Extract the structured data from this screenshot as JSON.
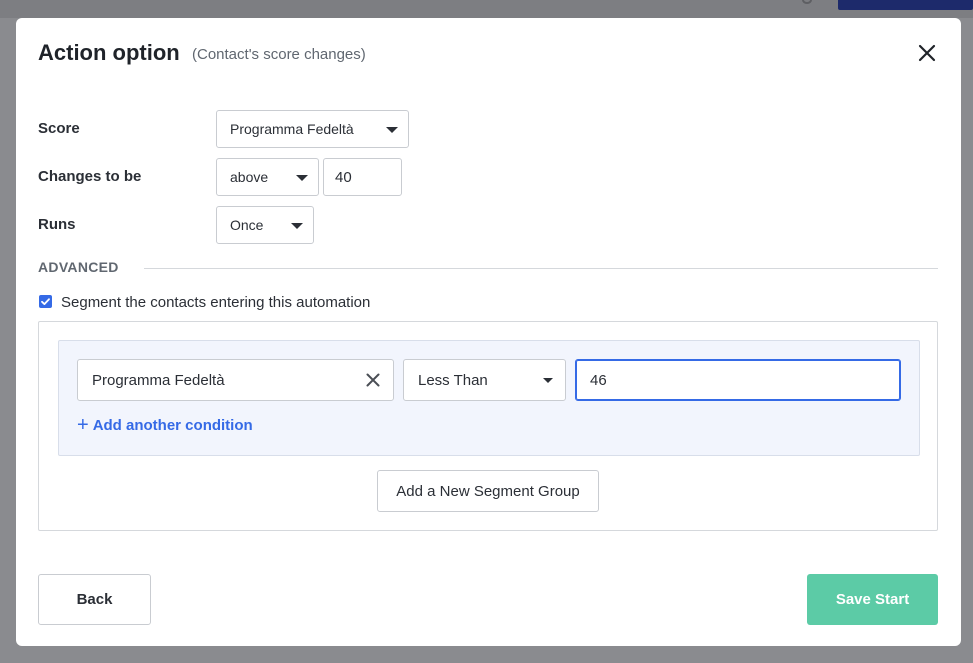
{
  "modal": {
    "title": "Action option",
    "subtitle": "(Contact's score changes)"
  },
  "form": {
    "score": {
      "label": "Score",
      "value": "Programma Fedeltà"
    },
    "changes": {
      "label": "Changes to be",
      "direction": "above",
      "amount": "40"
    },
    "runs": {
      "label": "Runs",
      "value": "Once"
    }
  },
  "advanced": {
    "label": "ADVANCED",
    "segment_checkbox_label": "Segment the contacts entering this automation",
    "segment_checked": true,
    "condition": {
      "field": "Programma Fedeltà",
      "operator": "Less Than",
      "value": "46"
    },
    "add_condition_label": "Add another condition",
    "new_group_label": "Add a New Segment Group"
  },
  "footer": {
    "back_label": "Back",
    "save_label": "Save Start"
  },
  "colors": {
    "accent": "#356ae6",
    "save": "#5ccba6"
  },
  "icons": [
    "close-icon",
    "caret-down-icon",
    "check-icon",
    "clear-icon",
    "plus-icon"
  ]
}
